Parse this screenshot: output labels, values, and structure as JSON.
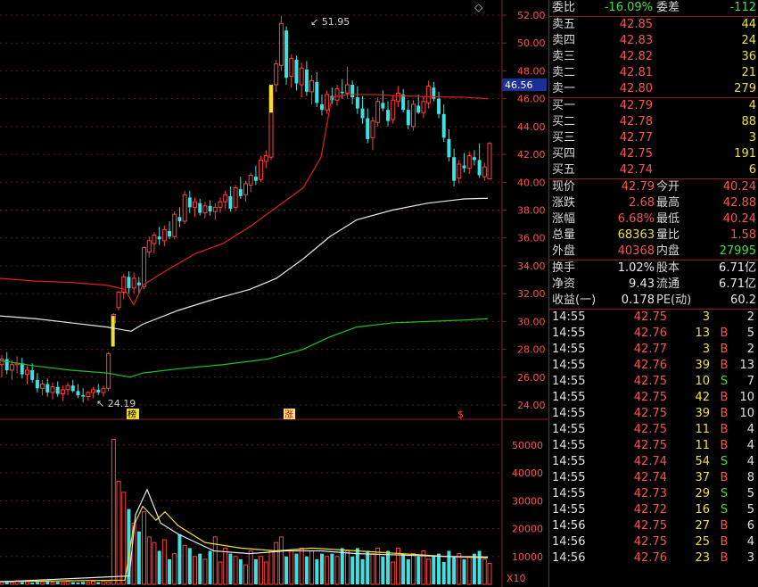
{
  "kline": {
    "price_axis": [
      "52.00",
      "50.00",
      "48.00",
      "46.00",
      "44.00",
      "42.00",
      "40.00",
      "38.00",
      "36.00",
      "34.00",
      "32.00",
      "30.00",
      "28.00",
      "26.00",
      "24.00"
    ],
    "high_label": "51.95",
    "low_label": "24.19",
    "current_tag": "46.56",
    "markers": [
      "榜",
      "涨",
      "$"
    ],
    "candles": [
      [
        26.9,
        27.6,
        26.0,
        27.3
      ],
      [
        27.3,
        27.8,
        26.2,
        26.5
      ],
      [
        26.5,
        27.2,
        25.8,
        26.9
      ],
      [
        26.9,
        27.5,
        26.3,
        27.0
      ],
      [
        27.0,
        27.4,
        25.9,
        26.2
      ],
      [
        26.2,
        26.8,
        25.5,
        26.5
      ],
      [
        26.5,
        27.0,
        25.6,
        25.8
      ],
      [
        25.8,
        26.3,
        24.9,
        25.2
      ],
      [
        25.2,
        25.8,
        24.7,
        25.5
      ],
      [
        25.5,
        25.9,
        24.6,
        24.9
      ],
      [
        24.9,
        25.6,
        24.4,
        25.3
      ],
      [
        25.3,
        25.7,
        24.6,
        24.8
      ],
      [
        24.8,
        25.4,
        24.3,
        25.1
      ],
      [
        25.1,
        25.6,
        24.7,
        25.4
      ],
      [
        25.4,
        25.8,
        24.9,
        25.0
      ],
      [
        25.0,
        25.5,
        24.5,
        24.7
      ],
      [
        24.7,
        25.2,
        24.19,
        24.6
      ],
      [
        24.6,
        25.0,
        24.3,
        24.9
      ],
      [
        24.9,
        25.3,
        24.5,
        25.1
      ],
      [
        25.1,
        25.5,
        24.7,
        24.9
      ],
      [
        24.9,
        25.4,
        24.6,
        25.2
      ],
      [
        25.2,
        27.8,
        25.0,
        27.7
      ],
      [
        29.9,
        30.6,
        29.1,
        30.5
      ],
      [
        31.0,
        32.2,
        30.8,
        32.1
      ],
      [
        32.1,
        33.4,
        31.6,
        33.2
      ],
      [
        33.2,
        33.6,
        32.0,
        32.4
      ],
      [
        32.4,
        33.5,
        32.0,
        33.1
      ],
      [
        32.8,
        33.2,
        32.0,
        32.6
      ],
      [
        32.5,
        35.4,
        32.3,
        35.3
      ],
      [
        35.0,
        36.1,
        34.6,
        35.8
      ],
      [
        35.6,
        36.4,
        34.9,
        36.2
      ],
      [
        36.1,
        36.8,
        35.5,
        35.9
      ],
      [
        35.8,
        36.9,
        35.4,
        36.6
      ],
      [
        36.5,
        37.2,
        35.9,
        36.1
      ],
      [
        36.1,
        37.9,
        35.9,
        37.7
      ],
      [
        37.5,
        38.2,
        36.8,
        37.2
      ],
      [
        37.2,
        39.4,
        37.0,
        39.1
      ],
      [
        38.9,
        39.4,
        37.8,
        38.2
      ],
      [
        38.2,
        38.9,
        37.5,
        38.6
      ],
      [
        38.5,
        38.8,
        37.6,
        37.8
      ],
      [
        37.8,
        38.6,
        37.4,
        38.3
      ],
      [
        38.3,
        38.7,
        37.6,
        37.9
      ],
      [
        37.9,
        38.5,
        37.3,
        38.2
      ],
      [
        38.2,
        38.9,
        37.8,
        38.6
      ],
      [
        38.6,
        39.4,
        38.1,
        39.1
      ],
      [
        39.0,
        39.7,
        37.9,
        38.1
      ],
      [
        38.2,
        39.8,
        38.0,
        39.6
      ],
      [
        39.5,
        40.4,
        38.8,
        39.0
      ],
      [
        39.1,
        40.1,
        38.6,
        39.9
      ],
      [
        39.8,
        40.7,
        39.3,
        40.5
      ],
      [
        40.4,
        41.2,
        39.8,
        40.1
      ],
      [
        40.2,
        41.9,
        40.0,
        41.6
      ],
      [
        41.5,
        42.3,
        41.0,
        41.9
      ],
      [
        41.8,
        43.5,
        41.6,
        46.9
      ],
      [
        47.0,
        48.8,
        46.5,
        48.5
      ],
      [
        48.4,
        51.95,
        48.0,
        51.4
      ],
      [
        50.9,
        51.2,
        47.0,
        47.5
      ],
      [
        47.6,
        49.2,
        46.8,
        48.9
      ],
      [
        48.8,
        49.1,
        46.6,
        47.1
      ],
      [
        47.0,
        48.6,
        46.1,
        48.2
      ],
      [
        48.1,
        48.7,
        46.2,
        46.5
      ],
      [
        46.5,
        47.7,
        45.6,
        47.3
      ],
      [
        47.2,
        47.9,
        45.4,
        45.7
      ],
      [
        45.6,
        46.3,
        44.8,
        45.2
      ],
      [
        45.2,
        46.6,
        44.9,
        46.3
      ],
      [
        46.2,
        46.8,
        45.6,
        45.9
      ],
      [
        45.9,
        47.0,
        45.5,
        46.7
      ],
      [
        46.5,
        47.4,
        46.0,
        46.4
      ],
      [
        46.4,
        48.3,
        46.0,
        47.0
      ],
      [
        47.0,
        47.3,
        45.6,
        46.1
      ],
      [
        46.1,
        46.9,
        44.9,
        45.3
      ],
      [
        45.3,
        46.2,
        44.2,
        44.6
      ],
      [
        44.6,
        45.3,
        42.8,
        43.1
      ],
      [
        43.2,
        44.7,
        42.3,
        44.4
      ],
      [
        44.3,
        46.1,
        44.0,
        45.8
      ],
      [
        45.7,
        46.6,
        45.1,
        45.3
      ],
      [
        45.2,
        45.8,
        44.0,
        44.4
      ],
      [
        44.5,
        46.2,
        44.2,
        45.9
      ],
      [
        45.8,
        46.9,
        45.4,
        46.4
      ],
      [
        46.3,
        46.7,
        45.0,
        45.2
      ],
      [
        45.2,
        45.9,
        43.8,
        44.1
      ],
      [
        44.0,
        45.9,
        43.7,
        45.6
      ],
      [
        45.5,
        46.3,
        44.9,
        45.0
      ],
      [
        45.0,
        46.2,
        44.6,
        45.8
      ],
      [
        45.7,
        47.3,
        45.3,
        46.9
      ],
      [
        46.8,
        47.2,
        45.8,
        46.0
      ],
      [
        46.0,
        46.5,
        44.6,
        44.9
      ],
      [
        44.9,
        45.6,
        42.9,
        43.2
      ],
      [
        43.1,
        43.8,
        41.5,
        41.8
      ],
      [
        41.8,
        42.4,
        39.7,
        40.1
      ],
      [
        40.3,
        41.6,
        39.9,
        41.3
      ],
      [
        41.2,
        42.1,
        40.7,
        41.0
      ],
      [
        41.0,
        42.2,
        40.6,
        41.9
      ],
      [
        41.8,
        42.3,
        41.2,
        41.6
      ],
      [
        41.6,
        42.8,
        40.3,
        40.5
      ],
      [
        40.4,
        41.4,
        40.1,
        41.1
      ],
      [
        40.24,
        42.88,
        40.24,
        42.79
      ]
    ],
    "ma_red": [
      [
        0,
        33.1
      ],
      [
        40,
        32.9
      ],
      [
        80,
        32.8
      ],
      [
        120,
        32.6
      ],
      [
        140,
        32.3
      ],
      [
        150,
        31.2
      ],
      [
        160,
        32.6
      ],
      [
        190,
        33.8
      ],
      [
        220,
        34.9
      ],
      [
        250,
        35.6
      ],
      [
        280,
        36.8
      ],
      [
        310,
        38.2
      ],
      [
        340,
        39.6
      ],
      [
        360,
        41.8
      ],
      [
        372,
        46.1
      ],
      [
        390,
        46.3
      ],
      [
        420,
        46.3
      ],
      [
        450,
        46.2
      ],
      [
        480,
        46.15
      ],
      [
        520,
        46.1
      ],
      [
        547,
        46.0
      ]
    ],
    "ma_white": [
      [
        0,
        30.4
      ],
      [
        40,
        30.2
      ],
      [
        80,
        29.9
      ],
      [
        120,
        29.6
      ],
      [
        147,
        29.3
      ],
      [
        160,
        29.8
      ],
      [
        200,
        30.8
      ],
      [
        240,
        31.6
      ],
      [
        280,
        32.3
      ],
      [
        310,
        33.1
      ],
      [
        340,
        34.5
      ],
      [
        370,
        36.1
      ],
      [
        400,
        37.3
      ],
      [
        440,
        38.0
      ],
      [
        480,
        38.5
      ],
      [
        520,
        38.8
      ],
      [
        547,
        38.85
      ]
    ],
    "ma_green": [
      [
        0,
        27.2
      ],
      [
        40,
        26.8
      ],
      [
        80,
        26.5
      ],
      [
        120,
        26.3
      ],
      [
        146,
        26.0
      ],
      [
        160,
        26.3
      ],
      [
        200,
        26.6
      ],
      [
        250,
        26.9
      ],
      [
        300,
        27.3
      ],
      [
        340,
        28.0
      ],
      [
        370,
        28.9
      ],
      [
        400,
        29.6
      ],
      [
        440,
        29.9
      ],
      [
        480,
        30.0
      ],
      [
        520,
        30.1
      ],
      [
        547,
        30.2
      ]
    ]
  },
  "volume": {
    "axis": [
      "50000",
      "40000",
      "30000",
      "20000",
      "10000"
    ],
    "multiplier": "X10",
    "bars": [
      900,
      1100,
      700,
      1300,
      800,
      1000,
      600,
      900,
      700,
      1200,
      800,
      900,
      700,
      1000,
      800,
      600,
      900,
      700,
      1100,
      800,
      1000,
      900,
      52000,
      37000,
      33000,
      27000,
      22000,
      19000,
      26000,
      17000,
      15000,
      12000,
      16000,
      9000,
      11000,
      18000,
      14000,
      13000,
      10000,
      11000,
      9000,
      12000,
      17000,
      8000,
      13000,
      11000,
      10000,
      9000,
      7000,
      12000,
      9000,
      10000,
      8000,
      12000,
      15000,
      17000,
      10000,
      12000,
      11000,
      13000,
      10000,
      12000,
      9000,
      11000,
      10000,
      11000,
      10000,
      13000,
      12000,
      10000,
      13000,
      9000,
      12000,
      11000,
      13000,
      10000,
      12000,
      8000,
      13000,
      11000,
      9000,
      11000,
      10000,
      12000,
      9000,
      10000,
      11000,
      8000,
      12000,
      10000,
      11000,
      9000,
      10000,
      11000,
      12000,
      9000,
      7500
    ],
    "line_yellow": [
      [
        0,
        1000
      ],
      [
        140,
        1500
      ],
      [
        150,
        21000
      ],
      [
        160,
        28000
      ],
      [
        175,
        23000
      ],
      [
        185,
        26000
      ],
      [
        200,
        21000
      ],
      [
        230,
        15000
      ],
      [
        270,
        13000
      ],
      [
        310,
        12000
      ],
      [
        350,
        13000
      ],
      [
        400,
        12000
      ],
      [
        450,
        11000
      ],
      [
        500,
        10000
      ],
      [
        547,
        9500
      ]
    ],
    "line_white": [
      [
        0,
        900
      ],
      [
        145,
        3000
      ],
      [
        152,
        25000
      ],
      [
        165,
        34000
      ],
      [
        180,
        22000
      ],
      [
        200,
        18000
      ],
      [
        240,
        12000
      ],
      [
        280,
        11000
      ],
      [
        320,
        12000
      ],
      [
        360,
        12000
      ],
      [
        400,
        11000
      ],
      [
        450,
        10500
      ],
      [
        500,
        10000
      ],
      [
        547,
        9800
      ]
    ]
  },
  "orderbook": {
    "weibi_label": "委比",
    "weibi_value": "-16.09%",
    "weicha_label": "委差",
    "weicha_value": "-112",
    "asks": [
      {
        "label": "卖五",
        "price": "42.85",
        "qty": "44"
      },
      {
        "label": "卖四",
        "price": "42.83",
        "qty": "24"
      },
      {
        "label": "卖三",
        "price": "42.82",
        "qty": "36"
      },
      {
        "label": "卖二",
        "price": "42.81",
        "qty": "21"
      },
      {
        "label": "卖一",
        "price": "42.80",
        "qty": "279"
      }
    ],
    "bids": [
      {
        "label": "买一",
        "price": "42.79",
        "qty": "4"
      },
      {
        "label": "买二",
        "price": "42.78",
        "qty": "88"
      },
      {
        "label": "买三",
        "price": "42.77",
        "qty": "3"
      },
      {
        "label": "买四",
        "price": "42.75",
        "qty": "191"
      },
      {
        "label": "买五",
        "price": "42.74",
        "qty": "6"
      }
    ]
  },
  "quote": [
    {
      "l1": "现价",
      "v1": "42.79",
      "c1": "red",
      "l2": "今开",
      "v2": "40.24",
      "c2": "red"
    },
    {
      "l1": "涨跌",
      "v1": "2.68",
      "c1": "red",
      "l2": "最高",
      "v2": "42.88",
      "c2": "red"
    },
    {
      "l1": "涨幅",
      "v1": "6.68%",
      "c1": "red",
      "l2": "最低",
      "v2": "40.24",
      "c2": "red"
    },
    {
      "l1": "总量",
      "v1": "68363",
      "c1": "yel",
      "l2": "量比",
      "v2": "1.58",
      "c2": "red"
    },
    {
      "l1": "外盘",
      "v1": "40368",
      "c1": "red",
      "l2": "内盘",
      "v2": "27995",
      "c2": "green"
    }
  ],
  "fundamentals": [
    {
      "l1": "换手",
      "v1": "1.02%",
      "l2": "股本",
      "v2": "6.71亿"
    },
    {
      "l1": "净资",
      "v1": "9.43",
      "l2": "流通",
      "v2": "6.71亿"
    },
    {
      "l1": "收益(一)",
      "v1": "0.178",
      "l2": "PE(动)",
      "v2": "60.2"
    }
  ],
  "trades": [
    {
      "time": "14:55",
      "price": "42.75",
      "qty": "3",
      "bs": "",
      "n": "2"
    },
    {
      "time": "14:55",
      "price": "42.76",
      "qty": "13",
      "bs": "B",
      "n": "5"
    },
    {
      "time": "14:55",
      "price": "42.77",
      "qty": "3",
      "bs": "B",
      "n": "2"
    },
    {
      "time": "14:55",
      "price": "42.76",
      "qty": "39",
      "bs": "B",
      "n": "13"
    },
    {
      "time": "14:55",
      "price": "42.75",
      "qty": "10",
      "bs": "S",
      "n": "7"
    },
    {
      "time": "14:55",
      "price": "42.75",
      "qty": "42",
      "bs": "B",
      "n": "10"
    },
    {
      "time": "14:55",
      "price": "42.75",
      "qty": "39",
      "bs": "B",
      "n": "10"
    },
    {
      "time": "14:55",
      "price": "42.75",
      "qty": "11",
      "bs": "B",
      "n": "4"
    },
    {
      "time": "14:55",
      "price": "42.75",
      "qty": "11",
      "bs": "B",
      "n": "4"
    },
    {
      "time": "14:55",
      "price": "42.74",
      "qty": "54",
      "bs": "S",
      "n": "4"
    },
    {
      "time": "14:55",
      "price": "42.74",
      "qty": "37",
      "bs": "B",
      "n": "8"
    },
    {
      "time": "14:55",
      "price": "42.73",
      "qty": "29",
      "bs": "S",
      "n": "5"
    },
    {
      "time": "14:55",
      "price": "42.72",
      "qty": "16",
      "bs": "S",
      "n": "5"
    },
    {
      "time": "14:56",
      "price": "42.75",
      "qty": "27",
      "bs": "B",
      "n": "6"
    },
    {
      "time": "14:56",
      "price": "42.75",
      "qty": "25",
      "bs": "B",
      "n": "4"
    },
    {
      "time": "14:56",
      "price": "42.76",
      "qty": "23",
      "bs": "B",
      "n": "3"
    }
  ]
}
